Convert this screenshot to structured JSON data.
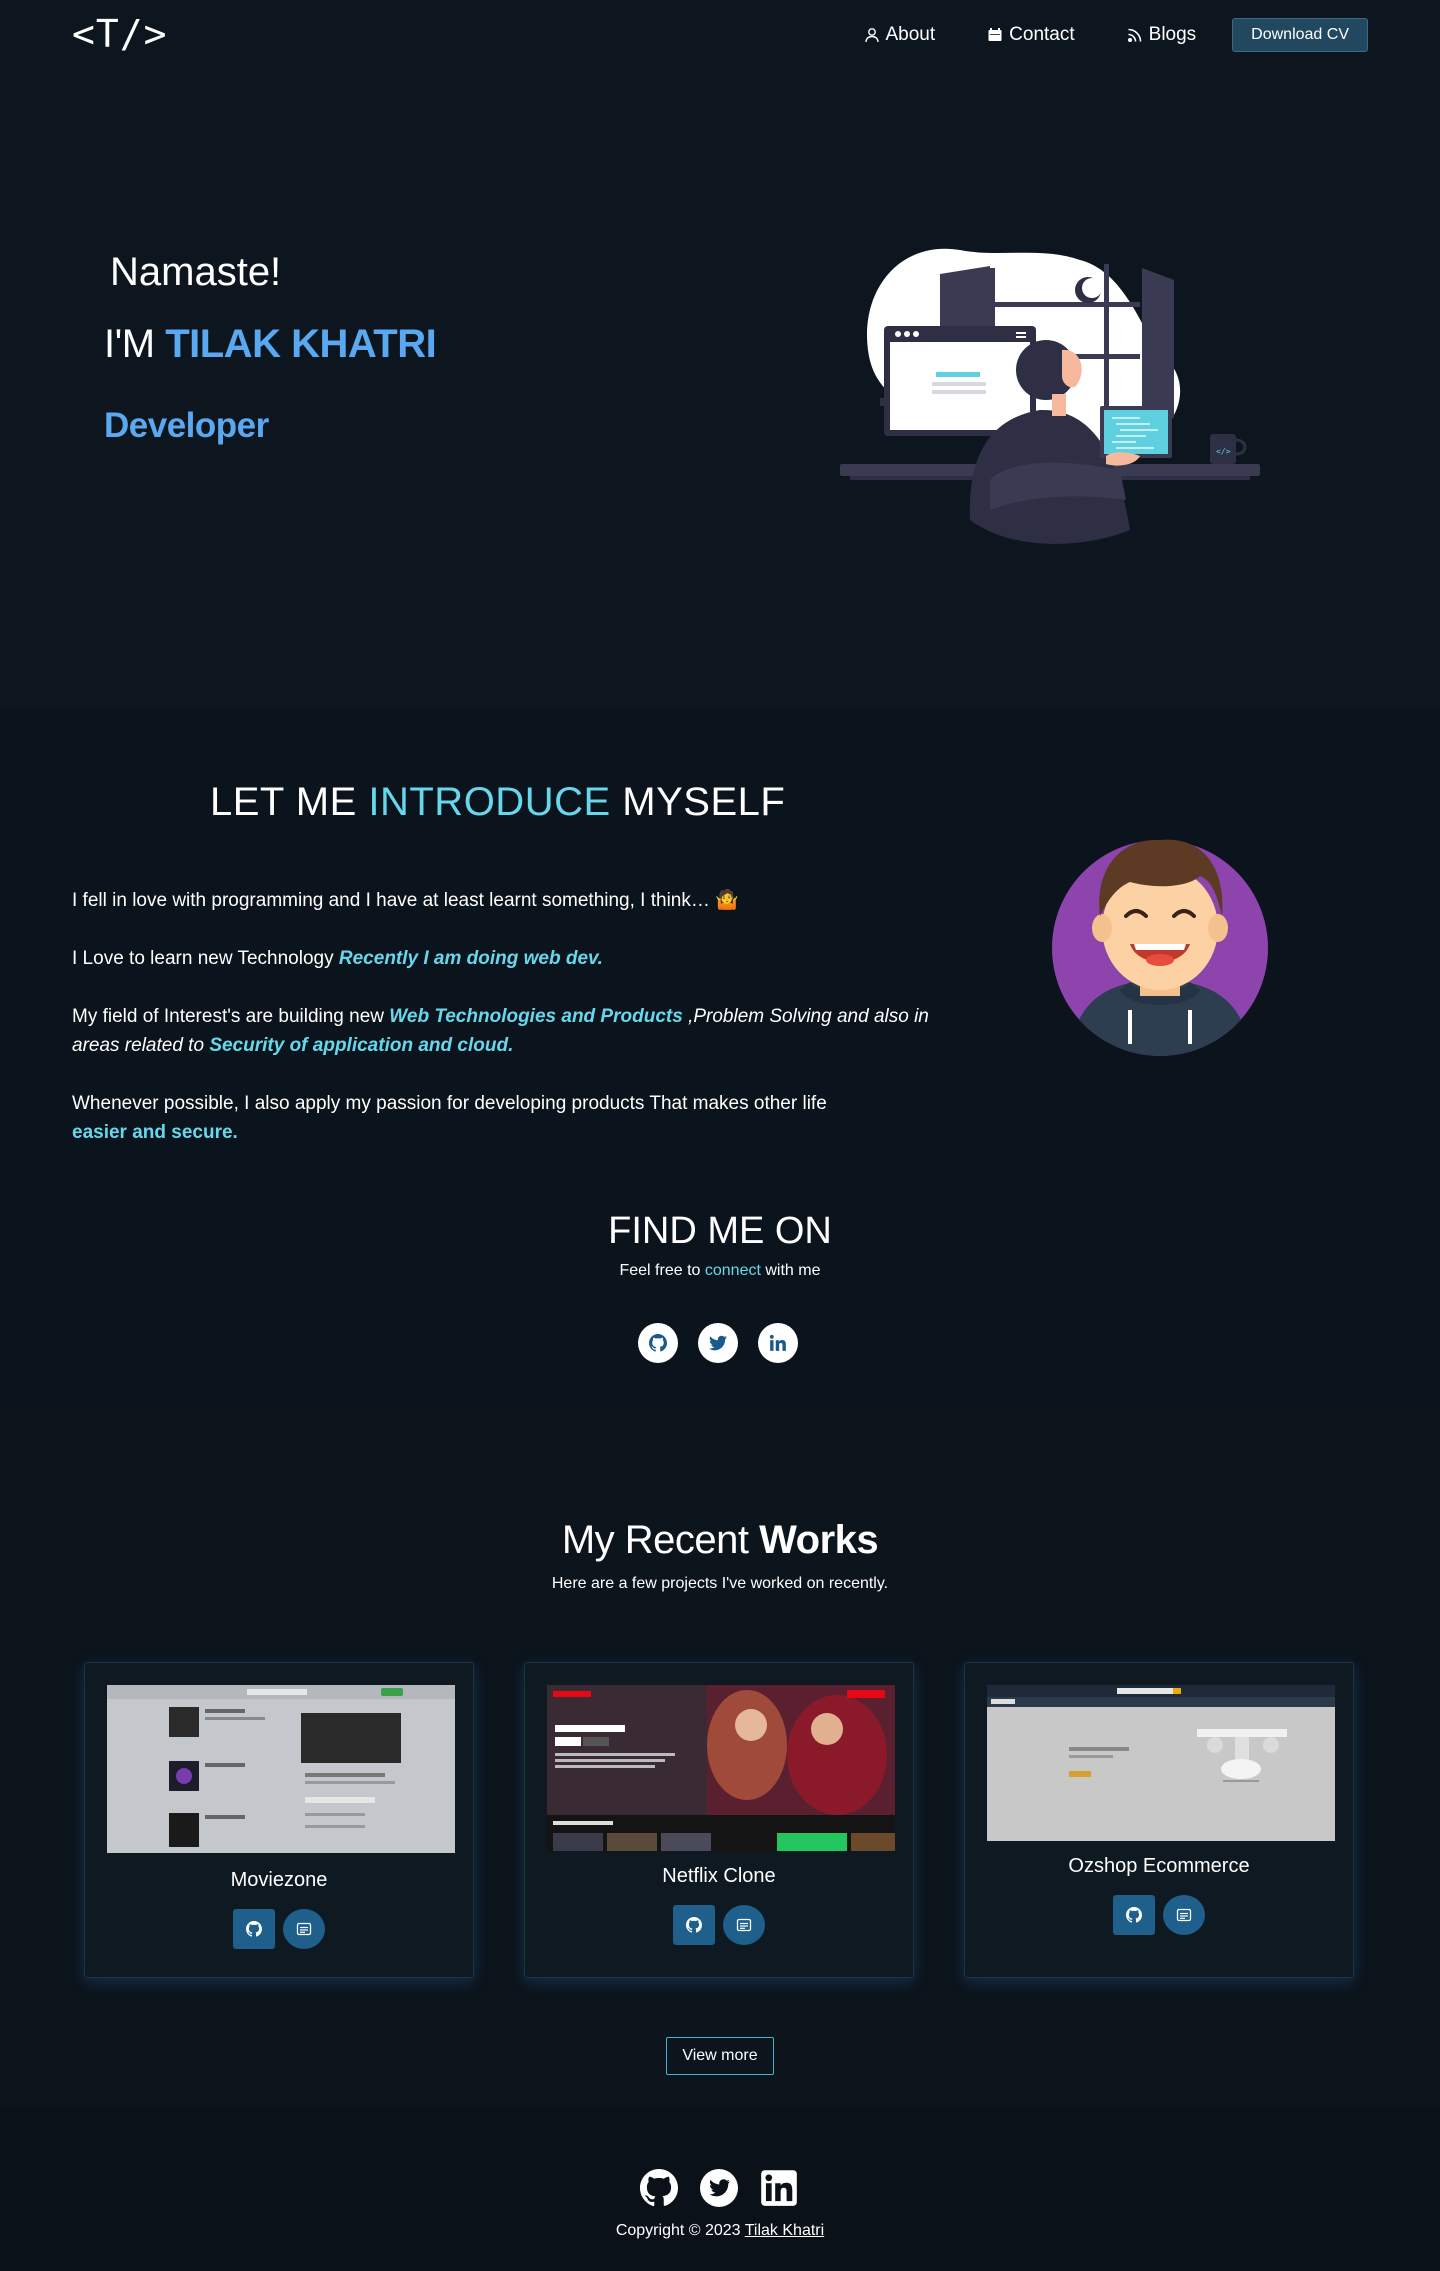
{
  "nav": {
    "logo": "<T/>",
    "about": "About",
    "contact": "Contact",
    "blogs": "Blogs",
    "download_cv": "Download CV"
  },
  "hero": {
    "greeting": "Namaste!",
    "iam_prefix": "I'M",
    "name": "TILAK KHATRI",
    "role": "Developer"
  },
  "intro": {
    "title_a": "LET ME",
    "title_b": "INTRODUCE",
    "title_c": "MYSELF",
    "p1": "I fell in love with programming and I have at least learnt something, I think… 🤷",
    "p2_plain": "I Love to learn new Technology",
    "p2_hl": "Recently I am doing web dev.",
    "p3_plain": "My field of Interest's are building new ",
    "p3_hl1": "Web Technologies and Products",
    "p3_it1": ",Problem Solving and also in areas related to",
    "p3_hl2": "Security of application and cloud.",
    "p4_plain": "Whenever possible, I also apply my passion for developing products That makes other life",
    "p4_hl": "easier and secure."
  },
  "find": {
    "title": "FIND ME ON",
    "sub_a": "Feel free to",
    "sub_link": "connect",
    "sub_b": "with me"
  },
  "works": {
    "title_a": "My Recent",
    "title_b": "Works",
    "subtitle": "Here are a few projects I've worked on recently.",
    "projects": [
      {
        "title": "Moviezone"
      },
      {
        "title": "Netflix Clone"
      },
      {
        "title": "Ozshop Ecommerce"
      }
    ],
    "view_more": "View more"
  },
  "footer": {
    "copy": "Copyright © 2023",
    "author": "Tilak Khatri"
  },
  "colors": {
    "accent_blue": "#5aa8f0",
    "accent_cyan": "#67d8ec",
    "background": "#0b131c"
  }
}
